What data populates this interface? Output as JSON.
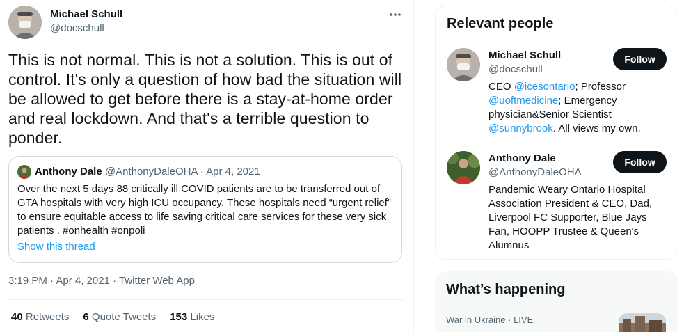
{
  "tweet": {
    "author_name": "Michael Schull",
    "author_handle": "@docschull",
    "text": "This is not normal. This is not a solution. This is out of control. It's only a question of how bad the situation will be allowed to get before there is a stay-at-home order and real lockdown. And that's a terrible question to ponder.",
    "more_icon": "more-horizontal-icon",
    "timestamp": "3:19 PM · Apr 4, 2021 · Twitter Web App",
    "stats": [
      {
        "count": "40",
        "label": "Retweets"
      },
      {
        "count": "6",
        "label": "Quote Tweets"
      },
      {
        "count": "153",
        "label": "Likes"
      }
    ]
  },
  "quoted_tweet": {
    "author_name": "Anthony Dale",
    "author_meta": "@AnthonyDaleOHA · Apr 4, 2021",
    "text": "Over the next 5 days 88 critically ill COVID patients are to be transferred out of GTA hospitals with very high ICU occupancy. These hospitals need “urgent relief” to ensure equitable access to life saving critical care services for these very sick patients . #onhealth #onpoli",
    "show_thread": "Show this thread"
  },
  "relevant_people": {
    "title": "Relevant people",
    "people": [
      {
        "name": "Michael Schull",
        "handle": "@docschull",
        "button": "Follow",
        "bio": [
          {
            "text": "CEO ",
            "mention": false
          },
          {
            "text": "@icesontario",
            "mention": true
          },
          {
            "text": "; Professor ",
            "mention": false
          },
          {
            "text": "@uoftmedicine",
            "mention": true
          },
          {
            "text": "; Emergency physician&Senior Scientist ",
            "mention": false
          },
          {
            "text": "@sunnybrook",
            "mention": true
          },
          {
            "text": ". All views my own.",
            "mention": false
          }
        ]
      },
      {
        "name": "Anthony Dale",
        "handle": "@AnthonyDaleOHA",
        "button": "Follow",
        "bio": [
          {
            "text": "Pandemic Weary Ontario Hospital Association President & CEO, Dad, Liverpool FC Supporter, Blue Jays Fan, HOOPP Trustee & Queen's Alumnus",
            "mention": false
          }
        ]
      }
    ]
  },
  "whats_happening": {
    "title": "What’s happening",
    "trend_topic": "War in Ukraine",
    "trend_status": "LIVE"
  },
  "colors": {
    "text": "#0f1419",
    "secondary": "#536471",
    "link": "#1d9bf0",
    "border": "#cfd9de",
    "button_bg": "#0f1419"
  }
}
